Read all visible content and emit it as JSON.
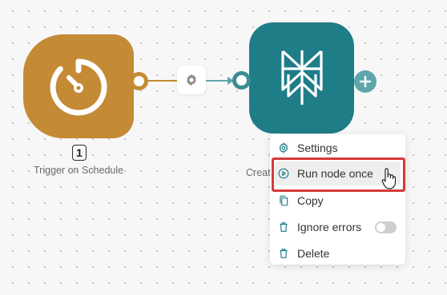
{
  "trigger_node": {
    "icon": "timer-icon",
    "run_count": "1",
    "label": "Trigger on Schedule",
    "color": "#c48a35"
  },
  "connector": {
    "settings_icon": "gear-icon"
  },
  "action_node": {
    "icon": "perplexity-logo-icon",
    "label": "Creat",
    "color": "#1f7d88",
    "add_icon": "plus-icon"
  },
  "context_menu": {
    "items": [
      {
        "label": "Settings",
        "icon": "gear-icon"
      },
      {
        "label": "Run node once",
        "icon": "play-circle-icon",
        "highlighted": true
      },
      {
        "label": "Copy",
        "icon": "copy-icon"
      },
      {
        "label": "Ignore errors",
        "icon": "trash-icon",
        "toggle": "off"
      },
      {
        "label": "Delete",
        "icon": "trash-icon"
      }
    ]
  },
  "highlight_color": "#d43a3a"
}
